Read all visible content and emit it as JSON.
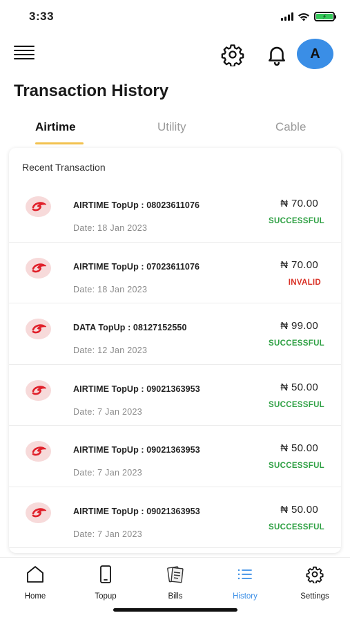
{
  "status_bar": {
    "time": "3:33"
  },
  "header": {
    "avatar_initial": "A"
  },
  "page_title": "Transaction History",
  "tabs": [
    {
      "label": "Airtime",
      "active": true
    },
    {
      "label": "Utility",
      "active": false
    },
    {
      "label": "Cable",
      "active": false
    }
  ],
  "card": {
    "title": "Recent Transaction",
    "transactions": [
      {
        "description": "AIRTIME TopUp : 08023611076",
        "date": "Date: 18 Jan 2023",
        "amount": "₦ 70.00",
        "status": "SUCCESSFUL"
      },
      {
        "description": "AIRTIME TopUp : 07023611076",
        "date": "Date: 18 Jan 2023",
        "amount": "₦ 70.00",
        "status": "INVALID"
      },
      {
        "description": "DATA TopUp : 08127152550",
        "date": "Date: 12 Jan 2023",
        "amount": "₦ 99.00",
        "status": "SUCCESSFUL"
      },
      {
        "description": "AIRTIME TopUp : 09021363953",
        "date": "Date: 7 Jan 2023",
        "amount": "₦ 50.00",
        "status": "SUCCESSFUL"
      },
      {
        "description": "AIRTIME TopUp : 09021363953",
        "date": "Date: 7 Jan 2023",
        "amount": "₦ 50.00",
        "status": "SUCCESSFUL"
      },
      {
        "description": "AIRTIME TopUp : 09021363953",
        "date": "Date: 7 Jan 2023",
        "amount": "₦ 50.00",
        "status": "SUCCESSFUL"
      }
    ]
  },
  "bottom_nav": [
    {
      "label": "Home",
      "icon": "home-icon"
    },
    {
      "label": "Topup",
      "icon": "phone-icon"
    },
    {
      "label": "Bills",
      "icon": "bills-icon"
    },
    {
      "label": "History",
      "icon": "list-icon",
      "active": true
    },
    {
      "label": "Settings",
      "icon": "gear-icon"
    }
  ],
  "colors": {
    "accent": "#3a8ee6",
    "tab_underline": "#f2c14e",
    "success": "#2ea043",
    "invalid": "#d93025",
    "icon_bg": "#f7dada",
    "brand_red": "#e0202a"
  }
}
